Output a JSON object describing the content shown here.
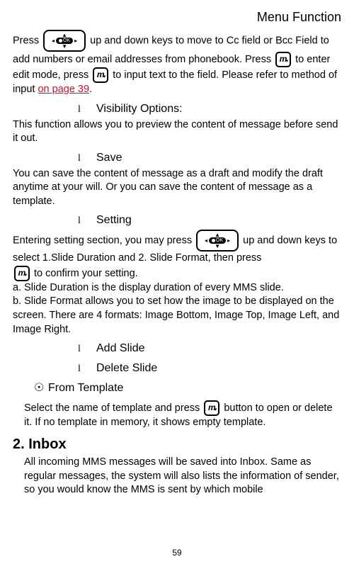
{
  "header": "Menu Function",
  "p1a": "Press ",
  "p1b": " up and down keys to move to Cc field or Bcc Field to add numbers or email addresses from phonebook. Press ",
  "p1c": " to enter edit mode, press ",
  "p1d": " to input text to the field. Please refer to method of input ",
  "link39": "on page 39",
  "p1e": ".",
  "bullet": "l",
  "vis_title": "Visibility Options:",
  "vis_body": "This function allows you to preview the content of message before send it out.",
  "save_title": "Save",
  "save_body": "You can save the content of message as a draft and modify the draft anytime at your will. Or you can save the content of message as a template.",
  "setting_title": "Setting",
  "setting_a": "Entering setting section, you may press ",
  "setting_b": " up and down keys to select 1.Slide Duration and 2. Slide Format, then press ",
  "setting_c": " to confirm your setting.",
  "setting_d": "a. Slide Duration is the display duration of every MMS slide.",
  "setting_e": "b. Slide Format allows you to set how the image to be displayed on the screen. There are 4 formats: Image Bottom, Image Top, Image Left, and Image Right.",
  "add_slide": "Add Slide",
  "delete_slide": "Delete Slide",
  "from_template_bullet": "☉",
  "from_template": "From Template",
  "tmpl_a": "Select the name of template and press ",
  "tmpl_b": " button to open or delete it.    If no template in memory, it shows empty template.",
  "inbox_h": "2. Inbox",
  "inbox_body": "All incoming MMS messages will be saved into Inbox. Same as regular messages, the system will also lists the information of sender, so you would know the MMS is sent by which mobile",
  "page_num": "59",
  "ok_label": "OK",
  "m_label": "m"
}
